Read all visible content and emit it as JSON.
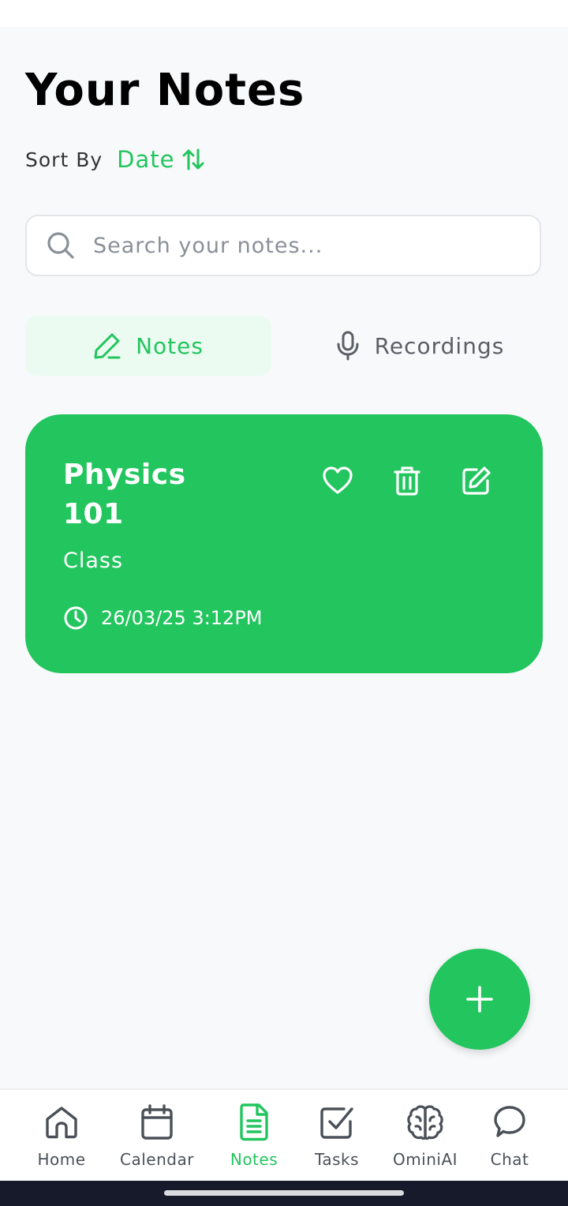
{
  "page": {
    "title": "Your Notes"
  },
  "sort": {
    "label": "Sort By",
    "value": "Date"
  },
  "search": {
    "placeholder": "Search your notes...",
    "value": ""
  },
  "tabs": [
    {
      "label": "Notes",
      "active": true,
      "icon": "pencil-icon"
    },
    {
      "label": "Recordings",
      "active": false,
      "icon": "microphone-icon"
    }
  ],
  "notes": [
    {
      "title": "Physics 101",
      "subtitle": "Class",
      "datetime": "26/03/25 3:12PM",
      "actions": [
        "heart-icon",
        "trash-icon",
        "edit-icon"
      ]
    }
  ],
  "nav": [
    {
      "label": "Home",
      "icon": "home-icon",
      "active": false
    },
    {
      "label": "Calendar",
      "icon": "calendar-icon",
      "active": false
    },
    {
      "label": "Notes",
      "icon": "document-icon",
      "active": true
    },
    {
      "label": "Tasks",
      "icon": "checkbox-icon",
      "active": false
    },
    {
      "label": "OminiAI",
      "icon": "brain-icon",
      "active": false
    },
    {
      "label": "Chat",
      "icon": "chat-bubble-icon",
      "active": false
    }
  ],
  "colors": {
    "accent": "#22c55e",
    "accent_light": "#ecfbf1",
    "background": "#f8f9fb",
    "nav_inactive": "#4b5058",
    "system_bar": "#161a2b"
  }
}
